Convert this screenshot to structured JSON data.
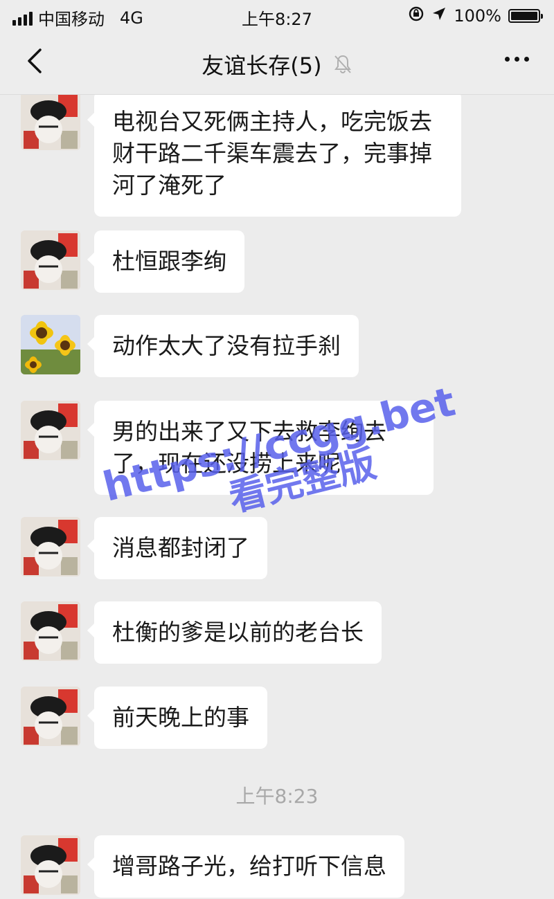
{
  "status_bar": {
    "carrier": "中国移动",
    "network": "4G",
    "time": "上午8:27",
    "battery": "100%"
  },
  "nav": {
    "title": "友谊长存(5)",
    "back_icon": "chevron-left-icon",
    "mute_icon": "bell-muted-icon",
    "more_icon": "more-dots-icon"
  },
  "messages": [
    {
      "text": "电视台又死俩主持人，吃完饭去财干路二千渠车震去了，完事掉河了淹死了",
      "avatar": "avatar-red"
    },
    {
      "text": "杜恒跟李绚",
      "avatar": "avatar-red"
    },
    {
      "text": "动作太大了没有拉手刹",
      "avatar": "avatar-sunflower"
    },
    {
      "text": "男的出来了又下去救李绚去了，现在还没捞上来呢",
      "avatar": "avatar-red"
    },
    {
      "text": "消息都封闭了",
      "avatar": "avatar-red"
    },
    {
      "text": "杜衡的爹是以前的老台长",
      "avatar": "avatar-red"
    },
    {
      "text": "前天晚上的事",
      "avatar": "avatar-red"
    },
    {
      "text": "增哥路子光，给打听下信息",
      "avatar": "avatar-red"
    }
  ],
  "timestamp": "上午8:23",
  "watermark": {
    "line1": "https://ccgg.bet",
    "line2": "看完整版",
    "color": "#5860eb"
  }
}
